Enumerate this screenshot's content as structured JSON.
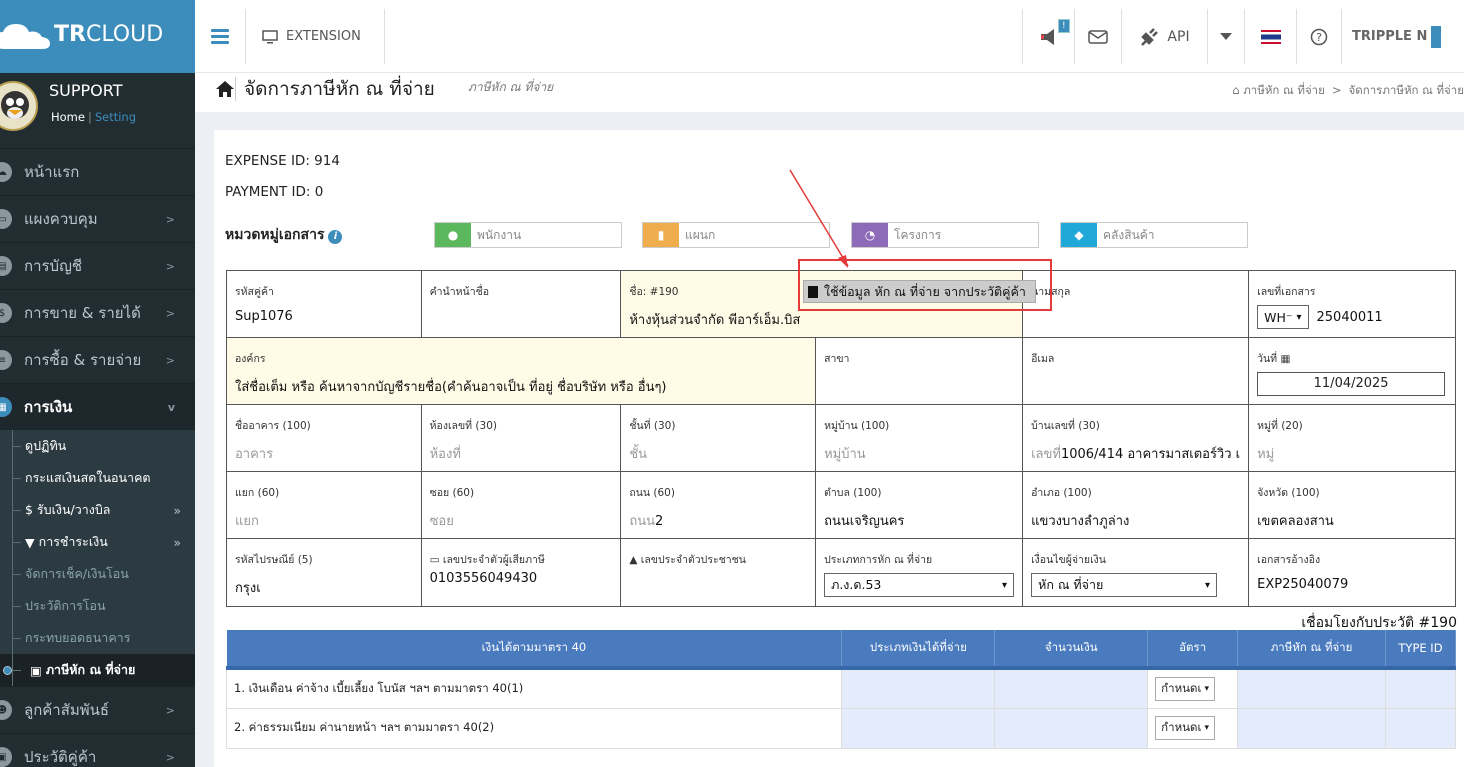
{
  "app": {
    "logo_bold": "TR",
    "logo_rest": "CLOUD"
  },
  "topnav": {
    "extension": "EXTENSION",
    "api": "API",
    "badge": "!",
    "company": "TRIPPLE N"
  },
  "user": {
    "name": "SUPPORT",
    "home": "Home",
    "sep": "|",
    "setting": "Setting"
  },
  "sidebar": {
    "items": [
      {
        "label": "หน้าแรก"
      },
      {
        "label": "แผงควบคุม"
      },
      {
        "label": "การบัญชี"
      },
      {
        "label": "การขาย & รายได้"
      },
      {
        "label": "การซื้อ & รายจ่าย"
      },
      {
        "label": "การเงิน"
      }
    ],
    "sub": [
      {
        "label": "ดูปฏิทิน"
      },
      {
        "label": "กระแสเงินสดในอนาคต"
      },
      {
        "label": "$ รับเงิน/วางบิล"
      },
      {
        "label": "การชำระเงิน"
      },
      {
        "label": "จัดการเช็ค/เงินโอน"
      },
      {
        "label": "ประวัติการโอน"
      },
      {
        "label": "กระทบยอดธนาคาร"
      },
      {
        "label": "ภาษีหัก ณ ที่จ่าย"
      }
    ],
    "after": [
      {
        "label": "ลูกค้าสัมพันธ์"
      },
      {
        "label": "ประวัติคู่ค้า"
      }
    ]
  },
  "page": {
    "title": "จัดการภาษีหัก ณ ที่จ่าย",
    "subtitle": "ภาษีหัก ณ ที่จ่าย",
    "breadcrumb": [
      "ภาษีหัก ณ ที่จ่าย",
      "จัดการภาษีหัก ณ ที่จ่าย"
    ],
    "breadcrumb_sep": ">",
    "expense_id": "EXPENSE ID: 914",
    "payment_id": "PAYMENT ID: 0",
    "category_label": "หมวดหมู่เอกสาร",
    "categories": [
      {
        "placeholder": "พนักงาน",
        "color": "#5cb85c"
      },
      {
        "placeholder": "แผนก",
        "color": "#f0ad4e"
      },
      {
        "placeholder": "โครงการ",
        "color": "#8e6bb8"
      },
      {
        "placeholder": "คลังสินค้า",
        "color": "#1fa8d8"
      }
    ]
  },
  "form": {
    "r1": {
      "code_l": "รหัสคู่ค้า",
      "code_v": "Sup1076",
      "prefix_l": "คำนำหน้าชื่อ",
      "name_l": "ชื่อ: #190",
      "name_v": "ห้างหุ้นส่วนจำกัด พีอาร์เอ็ม.บิส",
      "hist_btn": "ใช้ข้อมูล หัก ณ ที่จ่าย จากประวัติคู่ค้า",
      "surname_l": "นามสกุล",
      "doc_l": "เลขที่เอกสาร",
      "doc_prefix": "WH⁻",
      "doc_v": "25040011"
    },
    "r2": {
      "org_l": "องค์กร",
      "org_ph": "ใส่ชื่อเต็ม หรือ ค้นหาจากบัญชีรายชื่อ(คำค้นอาจเป็น ที่อยู่ ชื่อบริษัท หรือ อื่นๆ)",
      "branch_l": "สาขา",
      "email_l": "อีเมล",
      "date_l": "วันที่",
      "date_v": "11/04/2025"
    },
    "r3": {
      "bld_l": "ชื่ออาคาร (100)",
      "bld_ph": "อาคาร",
      "room_l": "ห้องเลขที่ (30)",
      "room_ph": "ห้องที่",
      "floor_l": "ชั้นที่ (30)",
      "floor_ph": "ชั้น",
      "vill_l": "หมู่บ้าน (100)",
      "vill_ph": "หมู่บ้าน",
      "hno_l": "บ้านเลขที่ (30)",
      "hno_pre": "เลขที่",
      "hno_v": "1006/414 อาคารมาสเตอร์วิว เ",
      "moo_l": "หมู่ที่ (20)",
      "moo_ph": "หมู่"
    },
    "r4": {
      "yaek_l": "แยก (60)",
      "yaek_ph": "แยก",
      "soi_l": "ซอย (60)",
      "soi_ph": "ซอย",
      "road_l": "ถนน (60)",
      "road_pre": "ถนน",
      "road_v": "2",
      "sub_l": "ตำบล (100)",
      "sub_v": "ถนนเจริญนคร",
      "dist_l": "อำเภอ (100)",
      "dist_v": "แขวงบางลำภูล่าง",
      "prov_l": "จังหวัด (100)",
      "prov_v": "เขตคลองสาน"
    },
    "r5": {
      "zip_l": "รหัสไปรษณีย์ (5)",
      "zip_v": "กรุงเ",
      "tax_l": "เลขประจำตัวผู้เสียภาษี",
      "tax_v": "0103556049430",
      "pid_l": "เลขประจำตัวประชาชน",
      "type_l": "ประเภทการหัก ณ ที่จ่าย",
      "type_v": "ภ.ง.ด.53",
      "cond_l": "เงื่อนไขผู้จ่ายเงิน",
      "cond_v": "หัก ณ ที่จ่าย",
      "ref_l": "เอกสารอ้างอิง",
      "ref_v": "EXP25040079"
    }
  },
  "linked": "เชื่อมโยงกับประวัติ #190",
  "income_table": {
    "headers": [
      "เงินได้ตามมาตรา 40",
      "ประเภทเงินได้ที่จ่าย",
      "จำนวนเงิน",
      "อัตรา",
      "ภาษีหัก ณ ที่จ่าย",
      "TYPE ID"
    ],
    "rows": [
      {
        "label": "1. เงินเดือน ค่าจ้าง เบี้ยเลี้ยง โบนัส ฯลฯ ตามมาตรา 40(1)",
        "rate": "กำหนดเ"
      },
      {
        "label": "2. ค่าธรรมเนียม ค่านายหน้า ฯลฯ ตามมาตรา 40(2)",
        "rate": "กำหนดเ"
      }
    ]
  }
}
